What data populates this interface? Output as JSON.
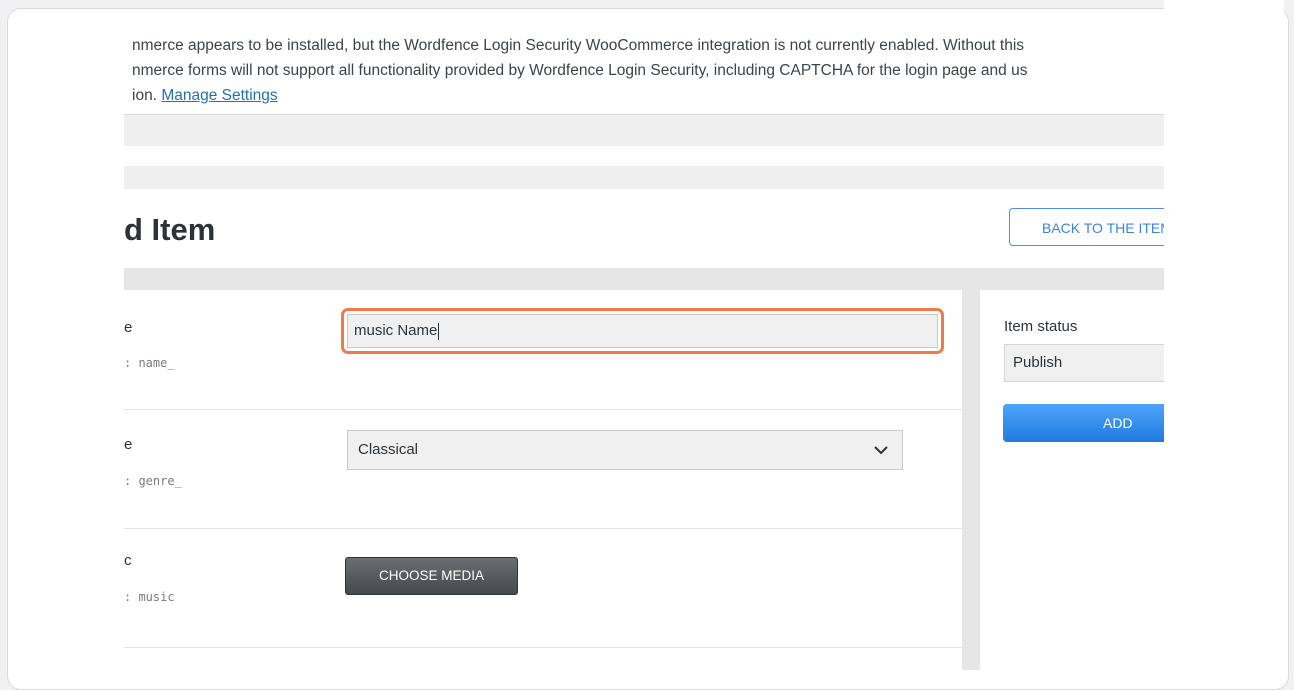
{
  "notice": {
    "line1": "nmerce appears to be installed, but the Wordfence Login Security WooCommerce integration is not currently enabled. Without this",
    "line2": "nmerce forms will not support all functionality provided by Wordfence Login Security, including CAPTCHA for the login page and us",
    "line3_prefix": "ion. ",
    "manage_link": "Manage Settings"
  },
  "page": {
    "title": "d Item",
    "back_button": "BACK TO THE ITEM"
  },
  "fields": [
    {
      "label": "e",
      "key": ": name_",
      "value": "music Name"
    },
    {
      "label": "e",
      "key": ": genre_",
      "value": "Classical"
    },
    {
      "label": "c",
      "key": ": music",
      "button": "CHOOSE MEDIA"
    }
  ],
  "sidebar": {
    "status_label": "Item status",
    "status_value": "Publish",
    "add_button": "ADD"
  },
  "icons": {
    "select_arrow": "chevron-down-icon"
  },
  "colors": {
    "highlight": "#f07a4a",
    "accent": "#1f7bdf",
    "link": "#2271b1"
  }
}
